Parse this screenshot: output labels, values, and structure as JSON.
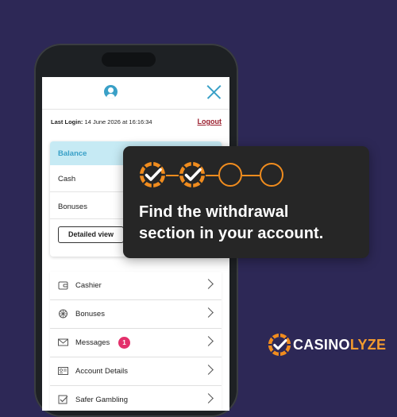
{
  "screen": {
    "last_login_label": "Last Login:",
    "last_login_value": "14 June 2026 at 16:16:34",
    "logout_label": "Logout"
  },
  "balance": {
    "title": "Balance",
    "cash_label": "Cash",
    "bonuses_label": "Bonuses",
    "detailed_view_label": "Detailed view"
  },
  "menu": {
    "items": [
      {
        "label": "Cashier",
        "icon": "wallet-icon"
      },
      {
        "label": "Bonuses",
        "icon": "gift-icon"
      },
      {
        "label": "Messages",
        "icon": "mail-icon",
        "badge": "1"
      },
      {
        "label": "Account Details",
        "icon": "id-card-icon"
      },
      {
        "label": "Safer Gambling",
        "icon": "checkbox-icon"
      }
    ]
  },
  "overlay": {
    "line1": "Find the withdrawal",
    "line2": "section in your account.",
    "steps_completed": 2,
    "steps_total": 4
  },
  "brand": {
    "name_part1": "CASINO",
    "name_part2": "LYZE"
  },
  "colors": {
    "background": "#2d2856",
    "accent_orange": "#f08c1e",
    "accent_blue": "#39a0c7",
    "logout_red": "#9a1e2d",
    "badge_pink": "#e3306b"
  }
}
